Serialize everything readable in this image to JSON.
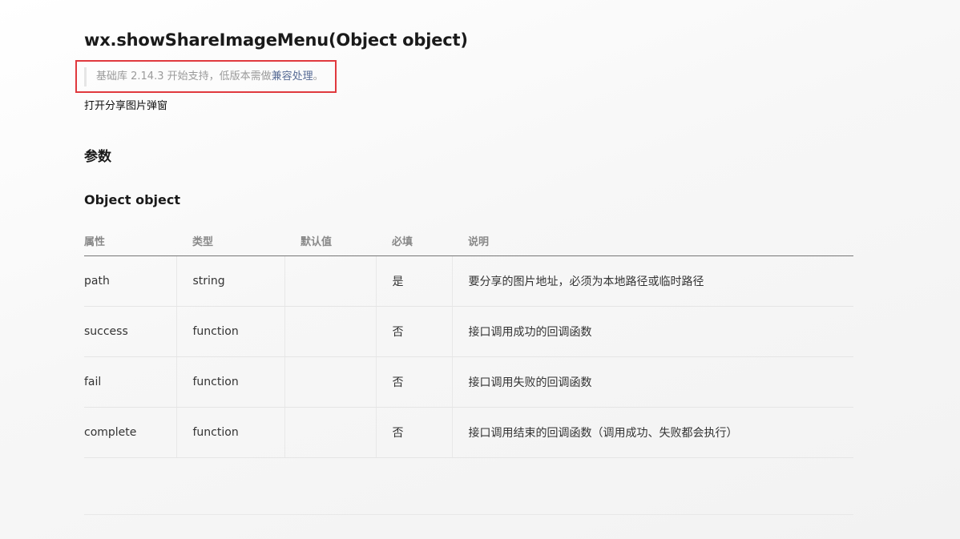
{
  "page": {
    "title": "wx.showShareImageMenu(Object object)",
    "support": {
      "prefix": "基础库 2.14.3 开始支持，低版本需做",
      "link": "兼容处理",
      "suffix": "。"
    },
    "description": "打开分享图片弹窗",
    "params_heading": "参数",
    "object_heading": "Object object"
  },
  "table": {
    "headers": [
      "属性",
      "类型",
      "默认值",
      "必填",
      "说明"
    ],
    "rows": [
      {
        "name": "path",
        "type": "string",
        "default": "",
        "required": "是",
        "desc": "要分享的图片地址，必须为本地路径或临时路径"
      },
      {
        "name": "success",
        "type": "function",
        "default": "",
        "required": "否",
        "desc": "接口调用成功的回调函数"
      },
      {
        "name": "fail",
        "type": "function",
        "default": "",
        "required": "否",
        "desc": "接口调用失败的回调函数"
      },
      {
        "name": "complete",
        "type": "function",
        "default": "",
        "required": "否",
        "desc": "接口调用结束的回调函数（调用成功、失败都会执行）"
      }
    ]
  },
  "colors": {
    "highlight_border": "#e0393e",
    "link": "#576b95"
  }
}
